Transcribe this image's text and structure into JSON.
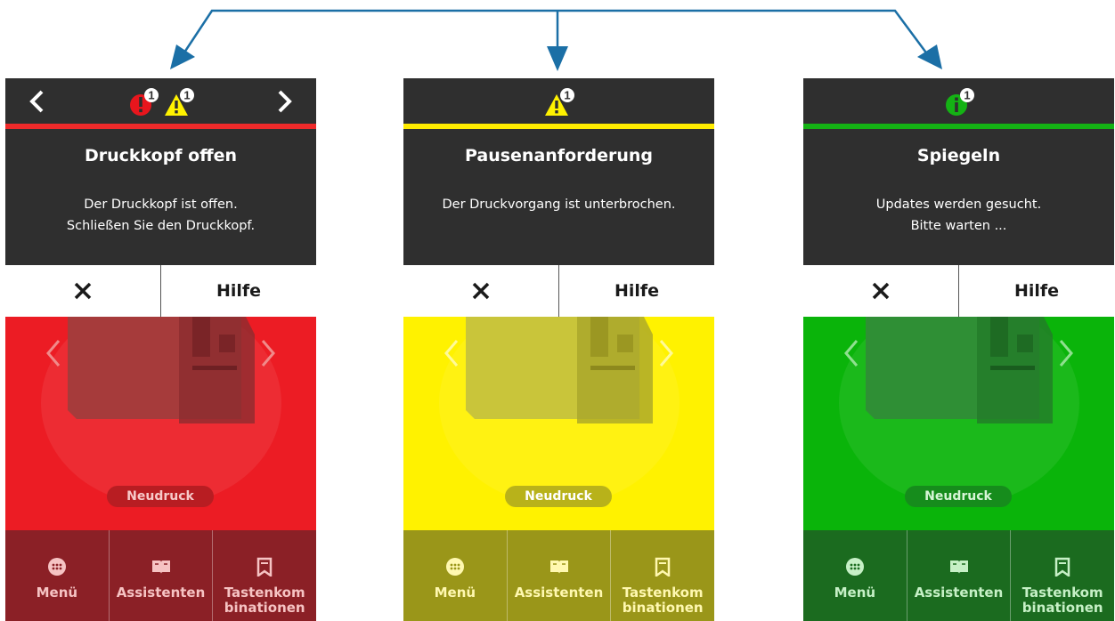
{
  "screens": [
    {
      "alert_title": "Druckkopf offen",
      "alert_line1": "Der Druckkopf ist offen.",
      "alert_line2": "Schließen Sie den Druckkopf.",
      "help_label": "Hilfe",
      "reprint_label": "Neudruck",
      "nav": {
        "menu": "Menü",
        "wizards": "Assistenten",
        "shortcuts_1": "Tastenkom",
        "shortcuts_2": "binationen"
      },
      "badges": {
        "error_count": "1",
        "warning_count": "1"
      },
      "colors": {
        "accent": "#ee2a2a",
        "home_bg": "#ec1c24",
        "nav_bg": "#8b2026",
        "nav_text": "#f6c3c3",
        "pill_bg": "#b81d22",
        "pill_text": "#f7c9c9",
        "printer": "#a63b3b"
      },
      "icons": [
        "chevron-left-icon",
        "error-badge-icon",
        "warning-badge-icon",
        "chevron-right-icon"
      ]
    },
    {
      "alert_title": "Pausenanforderung",
      "alert_line1": "Der Druckvorgang ist unterbrochen.",
      "alert_line2": "",
      "help_label": "Hilfe",
      "reprint_label": "Neudruck",
      "nav": {
        "menu": "Menü",
        "wizards": "Assistenten",
        "shortcuts_1": "Tastenkom",
        "shortcuts_2": "binationen"
      },
      "badges": {
        "warning_count": "1"
      },
      "colors": {
        "accent": "#ffec00",
        "home_bg": "#fff200",
        "nav_bg": "#9a9619",
        "nav_text": "#fff8b0",
        "pill_bg": "#b8b21a",
        "pill_text": "#ffffff",
        "printer": "#c9c53a"
      },
      "icons": [
        "warning-badge-icon"
      ]
    },
    {
      "alert_title": "Spiegeln",
      "alert_line1": "Updates werden gesucht.",
      "alert_line2": "Bitte warten ...",
      "help_label": "Hilfe",
      "reprint_label": "Neudruck",
      "nav": {
        "menu": "Menü",
        "wizards": "Assistenten",
        "shortcuts_1": "Tastenkom",
        "shortcuts_2": "binationen"
      },
      "badges": {
        "info_count": "1"
      },
      "colors": {
        "accent": "#14b214",
        "home_bg": "#0ab40a",
        "nav_bg": "#1b6b1f",
        "nav_text": "#c6f0c6",
        "pill_bg": "#168c1c",
        "pill_text": "#d6f5d6",
        "printer": "#2f8f35"
      },
      "icons": [
        "info-badge-icon"
      ]
    }
  ],
  "connector_color": "#1b6fa6"
}
